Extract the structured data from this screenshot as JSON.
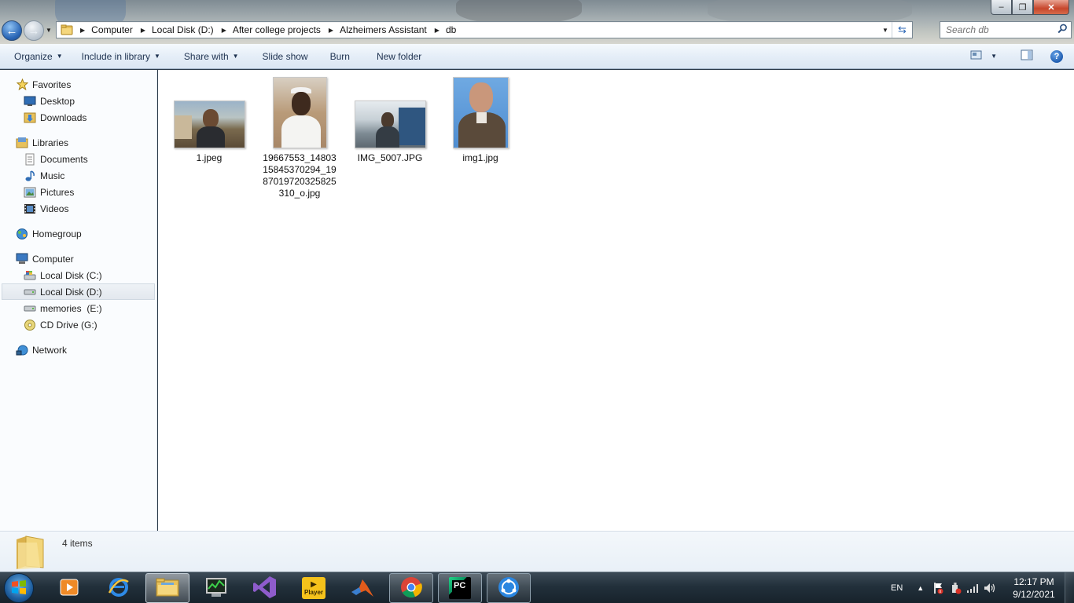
{
  "window": {
    "caption_buttons": {
      "minimize": "–",
      "maximize": "❐",
      "close": "✕"
    }
  },
  "address_bar": {
    "breadcrumbs": [
      "Computer",
      "Local Disk (D:)",
      "After college projects",
      "Alzheimers Assistant",
      "db"
    ]
  },
  "search": {
    "placeholder": "Search db"
  },
  "commandbar": {
    "organize": "Organize",
    "include_in_library": "Include in library",
    "share_with": "Share with",
    "slide_show": "Slide show",
    "burn": "Burn",
    "new_folder": "New folder",
    "help": "?"
  },
  "navpane": {
    "favorites": {
      "label": "Favorites",
      "items": [
        "Desktop",
        "Downloads"
      ]
    },
    "libraries": {
      "label": "Libraries",
      "items": [
        "Documents",
        "Music",
        "Pictures",
        "Videos"
      ]
    },
    "homegroup": {
      "label": "Homegroup"
    },
    "computer": {
      "label": "Computer",
      "items": [
        "Local Disk (C:)",
        "Local Disk (D:)",
        "memories  (E:)",
        "CD Drive (G:)"
      ],
      "selected": "Local Disk (D:)"
    },
    "network": {
      "label": "Network"
    }
  },
  "files": [
    {
      "name": "1.jpeg"
    },
    {
      "name": "19667553_1480315845370294_1987019720325825310_o.jpg"
    },
    {
      "name": "IMG_5007.JPG"
    },
    {
      "name": "img1.jpg"
    }
  ],
  "details": {
    "item_count": "4 items"
  },
  "taskbar": {
    "apps": [
      "Windows Media Player",
      "Internet Explorer",
      "Windows Explorer",
      "Task Manager",
      "Visual Studio",
      "KMPlayer",
      "MATLAB",
      "Google Chrome",
      "PyCharm",
      "SHAREit"
    ],
    "kmplayer_label": "Player",
    "pycharm_label": "PC",
    "language": "EN",
    "show_hidden": "▲",
    "time": "12:17 PM",
    "date": "9/12/2021"
  },
  "colors": {
    "accent": "#2a66b6",
    "commandbar_text": "#1e3250",
    "taskbar": "#22303b"
  }
}
